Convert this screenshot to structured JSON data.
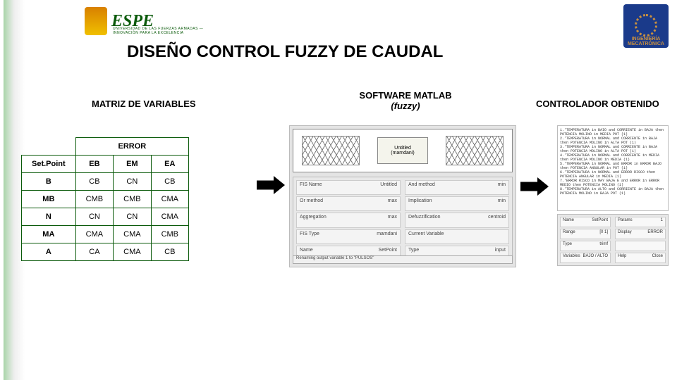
{
  "logos": {
    "espe_text": "ESPE",
    "espe_sub": "UNIVERSIDAD DE LAS FUERZAS ARMADAS — INNOVACIÓN PARA LA EXCELENCIA",
    "right_line1": "INGENIERÍA",
    "right_line2": "MECATRÓNICA"
  },
  "title": "DISEÑO CONTROL FUZZY DE CAUDAL",
  "sections": {
    "matriz": "MATRIZ DE VARIABLES",
    "software_l1": "SOFTWARE MATLAB",
    "software_l2": "(fuzzy)",
    "controlador": "CONTROLADOR OBTENIDO"
  },
  "matrix": {
    "error_header": "ERROR",
    "row_header": "Set.Point",
    "cols": [
      "EB",
      "EM",
      "EA"
    ],
    "rows": [
      {
        "name": "B",
        "cells": [
          "CB",
          "CN",
          "CB"
        ]
      },
      {
        "name": "MB",
        "cells": [
          "CMB",
          "CMB",
          "CMA"
        ]
      },
      {
        "name": "N",
        "cells": [
          "CN",
          "CN",
          "CMA"
        ]
      },
      {
        "name": "MA",
        "cells": [
          "CMA",
          "CMA",
          "CMB"
        ]
      },
      {
        "name": "A",
        "cells": [
          "CA",
          "CMA",
          "CB"
        ]
      }
    ]
  },
  "matlab": {
    "mid_box_l1": "Untitled",
    "mid_box_l2": "(mamdani)",
    "in_label": "SetPoint",
    "in_label2": "ERROR",
    "out_label": "PULSOS",
    "props": [
      [
        "FIS Name",
        "Untitled"
      ],
      [
        "And method",
        "min"
      ],
      [
        "Or method",
        "max"
      ],
      [
        "Implication",
        "min"
      ],
      [
        "Aggregation",
        "max"
      ],
      [
        "Defuzzification",
        "centroid"
      ],
      [
        "FIS Type",
        "mamdani"
      ],
      [
        "Current Variable",
        ""
      ],
      [
        "Name",
        "SetPoint"
      ],
      [
        "Type",
        "input"
      ],
      [
        "Range",
        "[0 1]"
      ]
    ],
    "status": "Renaming output variable 1 to \"PULSOS\""
  },
  "code_lines": [
    "1.'TEMPERATURA in BAIO and CORRIENTE in BAJA then POTENCIA MOLINO in MEDIA POT (1)",
    "2.'TEMPERATURA in NORMAL and CORRIENTE in BAJA then POTENCIA MOLINO in ALTA POT (1)",
    "3.'TEMPERATURA in NORMAL and CORRIENTE in BAJA then POTENCIA MOLINO in ALTA POT (1)",
    "4.'TEMPERATURA in NORMAL and CORRIENTE in MEDIA then POTENCIA MOLINO in MEDIA (1)",
    "5.'TEMPERATURA in NORMAL and ERROR in ERROR BAJO then POTENCIA ANGULAR in POT (1)",
    "6.'TEMPERATURA in NORMAL and ERROR RISCO then POTENCIA ANGULAR in MEDIA (1)",
    "7.'ERROR RISCO in MAY BAJA E and ERROR in ERROR MEDIO then POTENCIA MOLINO (1)",
    "8.'TEMPERATURA in ALTO and CORRIENTE in BAJA then POTENCIA MOLINO in BAJA POT (1)"
  ],
  "props_right": [
    [
      "Name",
      "SetPoint"
    ],
    [
      "Params",
      "1"
    ],
    [
      "Range",
      "[0 1]"
    ],
    [
      "Display",
      "ERROR"
    ],
    [
      "Type",
      "trimf"
    ],
    [
      "",
      ""
    ],
    [
      "Variables",
      "BAJO / ALTO"
    ],
    [
      "Help",
      "Close"
    ]
  ]
}
